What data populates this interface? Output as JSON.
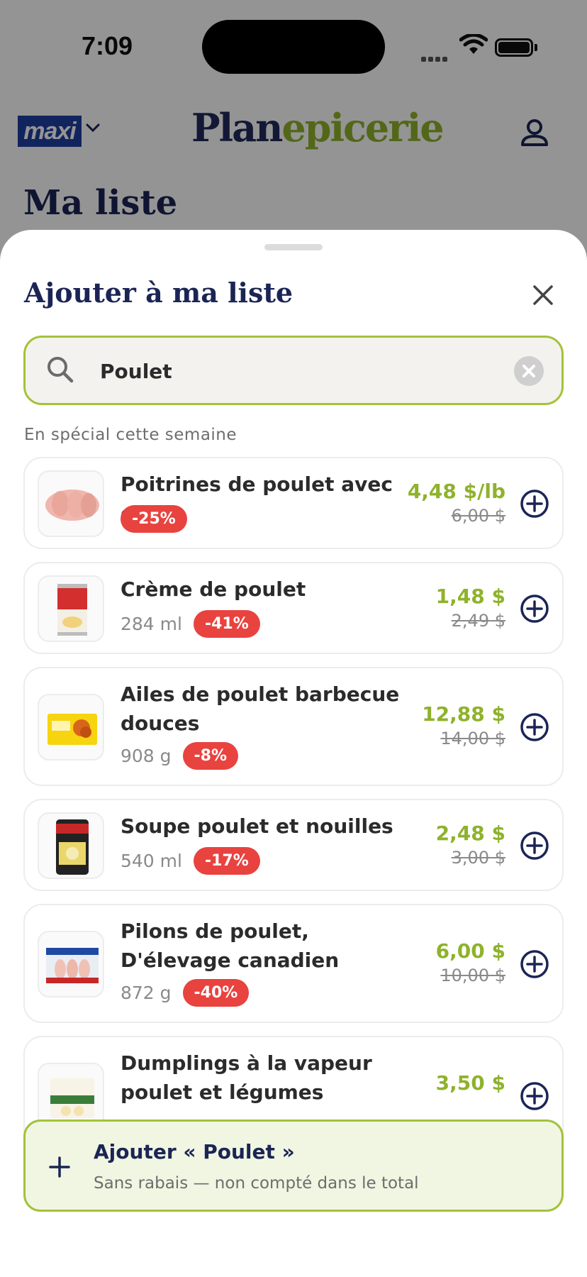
{
  "status": {
    "time": "7:09"
  },
  "header": {
    "store_badge": "maxi",
    "logo_main": "Plan",
    "logo_accent": "epicerie",
    "page_title": "Ma liste"
  },
  "sheet": {
    "title": "Ajouter à ma liste",
    "search": {
      "value": "Poulet"
    },
    "section_label": "En spécial cette semaine",
    "items": [
      {
        "name": "Poitrines de poulet avec os",
        "size": "",
        "discount": "-25%",
        "price": "4,48 $/lb",
        "was": "6,00 $"
      },
      {
        "name": "Crème de poulet",
        "size": "284 ml",
        "discount": "-41%",
        "price": "1,48 $",
        "was": "2,49 $"
      },
      {
        "name": "Ailes de poulet barbecue douces",
        "size": "908 g",
        "discount": "-8%",
        "price": "12,88 $",
        "was": "14,00 $"
      },
      {
        "name": "Soupe poulet et nouilles",
        "size": "540 ml",
        "discount": "-17%",
        "price": "2,48 $",
        "was": "3,00 $"
      },
      {
        "name": "Pilons de poulet, D'élevage canadien",
        "size": "872 g",
        "discount": "-40%",
        "price": "6,00 $",
        "was": "10,00 $"
      },
      {
        "name": "Dumplings à la vapeur poulet et légumes",
        "size": "",
        "discount": "",
        "price": "3,50 $",
        "was": ""
      }
    ],
    "footer": {
      "title": "Ajouter « Poulet »",
      "subtitle": "Sans rabais — non compté dans le total"
    }
  },
  "colors": {
    "accent_green": "#8fb22c",
    "navy": "#1b2555",
    "discount_red": "#e8433f"
  }
}
